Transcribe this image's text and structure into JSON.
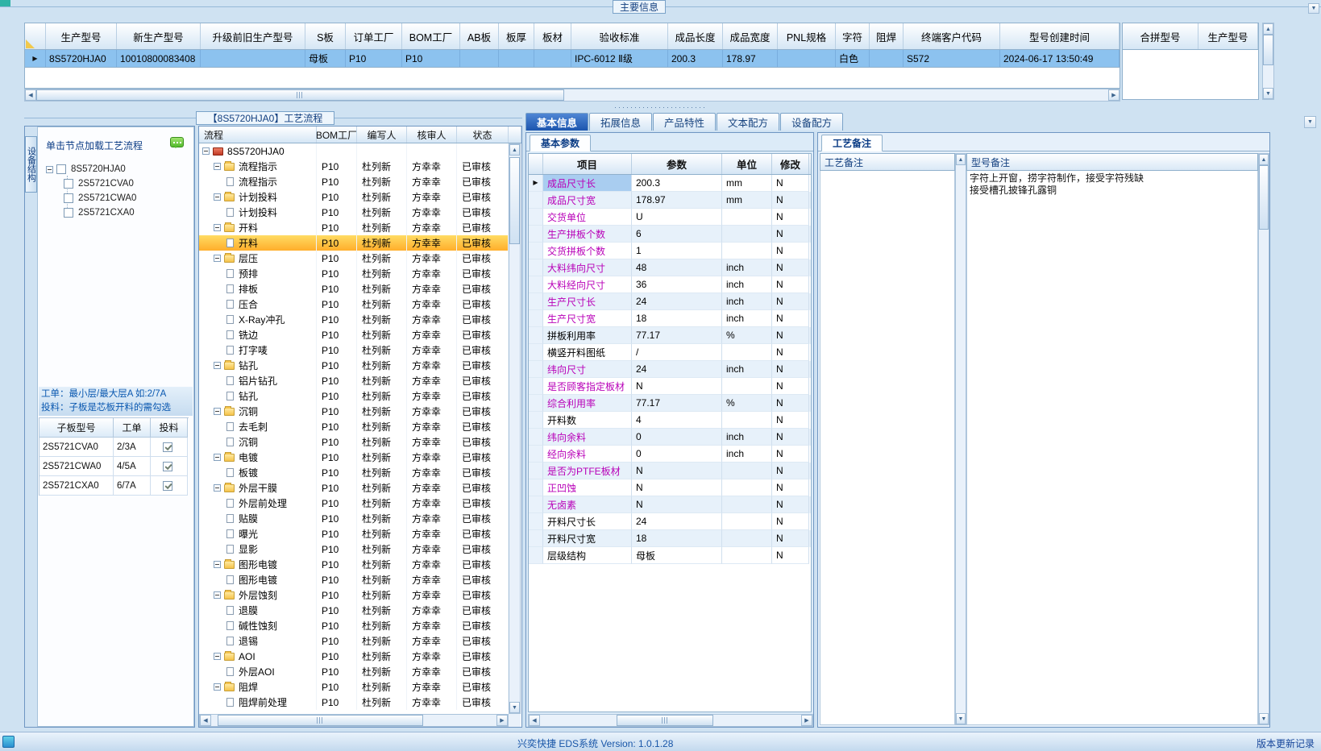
{
  "window": {
    "statusbar_title": "兴奕快捷 EDS系统 Version: 1.0.1.28",
    "statusbar_link": "版本更新记录"
  },
  "icons": {
    "scroll_left": "◀",
    "scroll_right": "▶",
    "scroll_up": "▲",
    "scroll_down": "▼",
    "dropdown": "▼",
    "row_indicator": "▶",
    "splitter_dots": "·······················"
  },
  "colors": {
    "selected_row_blue": "#8cc2ef",
    "flow_highlight_orange": "#ffae2b",
    "param_item_magenta": "#b800b8",
    "active_tab_blue": "#1c55ae",
    "solder_mask_color_value": "白色"
  },
  "main_grid": {
    "group_title": "主要信息",
    "columns": [
      "生产型号",
      "新生产型号",
      "升级前旧生产型号",
      "S板",
      "订单工厂",
      "BOM工厂",
      "AB板",
      "板厚",
      "板材",
      "验收标准",
      "成品长度",
      "成品宽度",
      "PNL规格",
      "字符",
      "阻焊",
      "终端客户代码",
      "型号创建时间"
    ],
    "row": [
      "8S5720HJA0",
      "10010800083408",
      "",
      "母板",
      "P10",
      "P10",
      "",
      "",
      "",
      "IPC-6012 Ⅱ级",
      "200.3",
      "178.97",
      "",
      "白色",
      "",
      "S572",
      "2024-06-17 13:50:49"
    ],
    "side_columns": [
      "合拼型号",
      "生产型号"
    ]
  },
  "flow_panel": {
    "title": "【8S5720HJA0】工艺流程",
    "left": {
      "vertical_tab": "设备结构",
      "hint": "单击节点加载工艺流程",
      "tree_root": "8S5720HJA0",
      "tree_children": [
        "2S5721CVA0",
        "2S5721CWA0",
        "2S5721CXA0"
      ],
      "note_line1": "工单：最小层/最大层A 如:2/7A",
      "note_line2": "投料：子板是芯板开料的需勾选",
      "sub_table": {
        "columns": [
          "子板型号",
          "工单",
          "投料"
        ],
        "rows": [
          {
            "model": "2S5721CVA0",
            "order": "2/3A",
            "checked": true
          },
          {
            "model": "2S5721CWA0",
            "order": "4/5A",
            "checked": true
          },
          {
            "model": "2S5721CXA0",
            "order": "6/7A",
            "checked": true
          }
        ]
      }
    },
    "table": {
      "columns": [
        "流程",
        "BOM工厂",
        "编写人",
        "核审人",
        "状态"
      ],
      "root": "8S5720HJA0",
      "bom": "P10",
      "writer": "杜列新",
      "reviewer": "方幸幸",
      "status": "已审核",
      "rows": [
        {
          "name": "流程指示",
          "kind": "folder"
        },
        {
          "name": "流程指示",
          "kind": "leaf"
        },
        {
          "name": "计划投料",
          "kind": "folder"
        },
        {
          "name": "计划投料",
          "kind": "leaf"
        },
        {
          "name": "开料",
          "kind": "folder"
        },
        {
          "name": "开料",
          "kind": "leaf",
          "highlight": true
        },
        {
          "name": "层压",
          "kind": "folder"
        },
        {
          "name": "预排",
          "kind": "leaf"
        },
        {
          "name": "排板",
          "kind": "leaf"
        },
        {
          "name": "压合",
          "kind": "leaf"
        },
        {
          "name": "X-Ray冲孔",
          "kind": "leaf"
        },
        {
          "name": "铣边",
          "kind": "leaf"
        },
        {
          "name": "打字唛",
          "kind": "leaf"
        },
        {
          "name": "钻孔",
          "kind": "folder"
        },
        {
          "name": "铝片钻孔",
          "kind": "leaf"
        },
        {
          "name": "钻孔",
          "kind": "leaf"
        },
        {
          "name": "沉铜",
          "kind": "folder"
        },
        {
          "name": "去毛刺",
          "kind": "leaf"
        },
        {
          "name": "沉铜",
          "kind": "leaf"
        },
        {
          "name": "电镀",
          "kind": "folder"
        },
        {
          "name": "板镀",
          "kind": "leaf"
        },
        {
          "name": "外层干膜",
          "kind": "folder"
        },
        {
          "name": "外层前处理",
          "kind": "leaf"
        },
        {
          "name": "贴膜",
          "kind": "leaf"
        },
        {
          "name": "曝光",
          "kind": "leaf"
        },
        {
          "name": "显影",
          "kind": "leaf"
        },
        {
          "name": "图形电镀",
          "kind": "folder"
        },
        {
          "name": "图形电镀",
          "kind": "leaf"
        },
        {
          "name": "外层蚀刻",
          "kind": "folder"
        },
        {
          "name": "退膜",
          "kind": "leaf"
        },
        {
          "name": "碱性蚀刻",
          "kind": "leaf"
        },
        {
          "name": "退锡",
          "kind": "leaf"
        },
        {
          "name": "AOI",
          "kind": "folder"
        },
        {
          "name": "外层AOI",
          "kind": "leaf"
        },
        {
          "name": "阻焊",
          "kind": "folder"
        },
        {
          "name": "阻焊前处理",
          "kind": "leaf"
        }
      ]
    }
  },
  "detail_panel": {
    "tabs": [
      "基本信息",
      "拓展信息",
      "产品特性",
      "文本配方",
      "设备配方"
    ],
    "active_tab": "基本信息",
    "sub_tab": "基本参数",
    "param_table": {
      "columns": [
        "项目",
        "参数",
        "单位",
        "修改"
      ],
      "rows": [
        {
          "item": "成品尺寸长",
          "value": "200.3",
          "unit": "mm",
          "mod": "N",
          "magenta": true,
          "selected": true
        },
        {
          "item": "成品尺寸宽",
          "value": "178.97",
          "unit": "mm",
          "mod": "N",
          "magenta": true
        },
        {
          "item": "交货单位",
          "value": "U",
          "unit": "",
          "mod": "N",
          "magenta": true
        },
        {
          "item": "生产拼板个数",
          "value": "6",
          "unit": "",
          "mod": "N",
          "magenta": true
        },
        {
          "item": "交货拼板个数",
          "value": "1",
          "unit": "",
          "mod": "N",
          "magenta": true
        },
        {
          "item": "大料纬向尺寸",
          "value": "48",
          "unit": "inch",
          "mod": "N",
          "magenta": true
        },
        {
          "item": "大料经向尺寸",
          "value": "36",
          "unit": "inch",
          "mod": "N",
          "magenta": true
        },
        {
          "item": "生产尺寸长",
          "value": "24",
          "unit": "inch",
          "mod": "N",
          "magenta": true
        },
        {
          "item": "生产尺寸宽",
          "value": "18",
          "unit": "inch",
          "mod": "N",
          "magenta": true
        },
        {
          "item": "拼板利用率",
          "value": "77.17",
          "unit": "%",
          "mod": "N",
          "magenta": false
        },
        {
          "item": "横竖开料图纸",
          "value": "/",
          "unit": "",
          "mod": "N",
          "magenta": false
        },
        {
          "item": "纬向尺寸",
          "value": "24",
          "unit": "inch",
          "mod": "N",
          "magenta": true
        },
        {
          "item": "是否顾客指定板材",
          "value": "N",
          "unit": "",
          "mod": "N",
          "magenta": true
        },
        {
          "item": "综合利用率",
          "value": "77.17",
          "unit": "%",
          "mod": "N",
          "magenta": true
        },
        {
          "item": "开料数",
          "value": "4",
          "unit": "",
          "mod": "N",
          "magenta": false
        },
        {
          "item": "纬向余料",
          "value": "0",
          "unit": "inch",
          "mod": "N",
          "magenta": true
        },
        {
          "item": "经向余料",
          "value": "0",
          "unit": "inch",
          "mod": "N",
          "magenta": true
        },
        {
          "item": "是否为PTFE板材",
          "value": "N",
          "unit": "",
          "mod": "N",
          "magenta": true
        },
        {
          "item": "正凹蚀",
          "value": "N",
          "unit": "",
          "mod": "N",
          "magenta": true
        },
        {
          "item": "无卤素",
          "value": "N",
          "unit": "",
          "mod": "N",
          "magenta": true
        },
        {
          "item": "开料尺寸长",
          "value": "24",
          "unit": "",
          "mod": "N",
          "magenta": false
        },
        {
          "item": "开料尺寸宽",
          "value": "18",
          "unit": "",
          "mod": "N",
          "magenta": false
        },
        {
          "item": "层级结构",
          "value": "母板",
          "unit": "",
          "mod": "N",
          "magenta": false
        }
      ]
    },
    "notes": {
      "tab": "工艺备注",
      "col1": "工艺备注",
      "col2": "型号备注",
      "model_note_lines": [
        "字符上开窗，捞字符制作，接受字符残缺",
        "接受槽孔披锋孔露铜"
      ]
    }
  }
}
